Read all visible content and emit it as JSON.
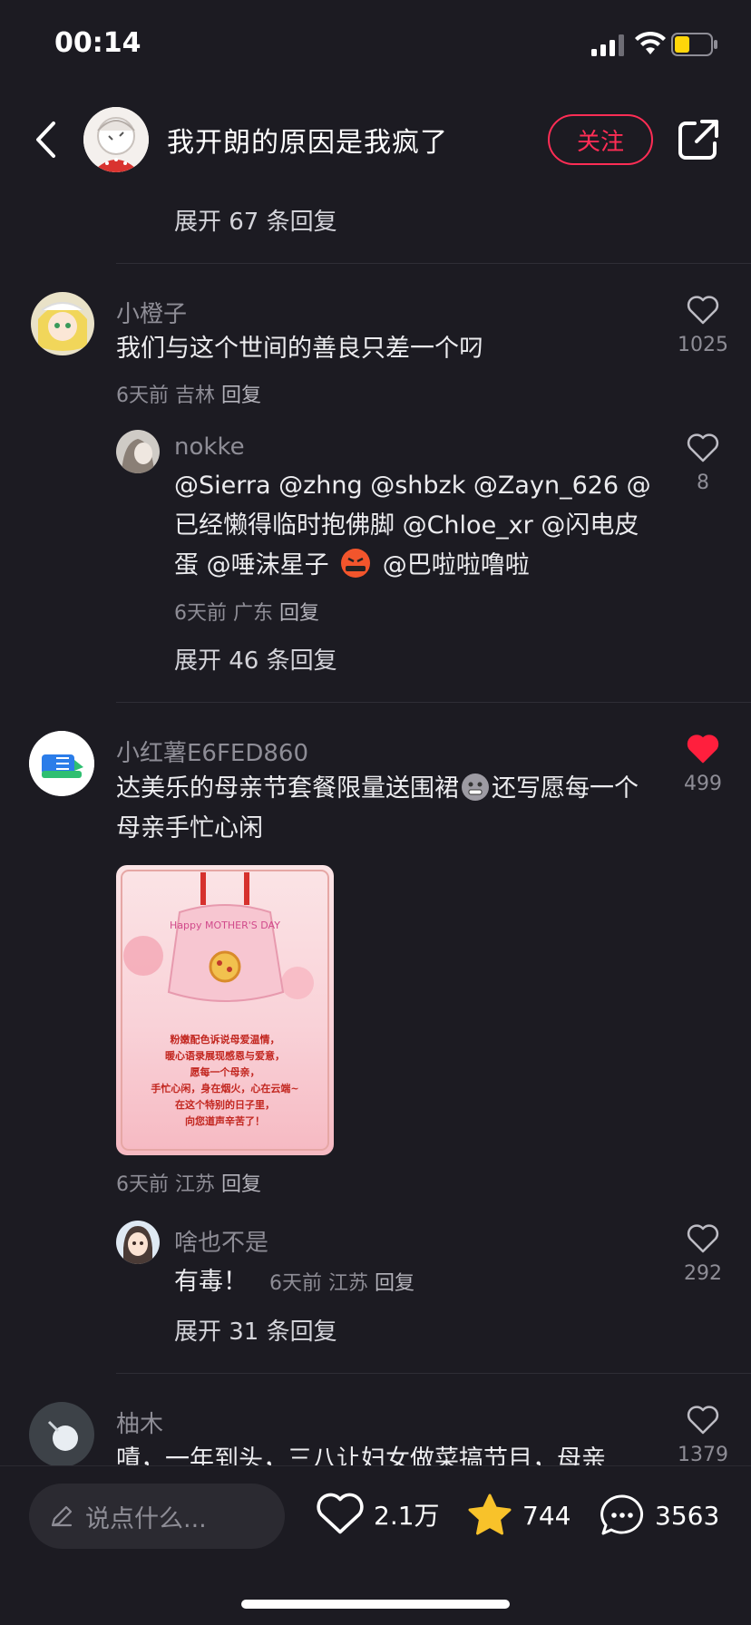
{
  "status": {
    "time": "00:14"
  },
  "header": {
    "title": "我开朗的原因是我疯了",
    "follow_label": "关注"
  },
  "top_expand": "展开 67 条回复",
  "comments": [
    {
      "username": "小橙子",
      "text": "我们与这个世间的善良只差一个叼",
      "time": "6天前",
      "location": "吉林",
      "reply_label": "回复",
      "likes": "1025",
      "liked": false,
      "replies": [
        {
          "username": "nokke",
          "text": "@Sierra @zhng @shbzk @Zayn_626 @已经懒得临时抱佛脚 @Chloe_xr @闪电皮蛋 @唾沫星子",
          "text_tail": "@巴啦啦噜啦",
          "time": "6天前",
          "location": "广东",
          "reply_label": "回复",
          "likes": "8"
        }
      ],
      "expand": "展开 46 条回复"
    },
    {
      "username": "小红薯E6FED860",
      "text_before_emoji": "达美乐的母亲节套餐限量送围裙",
      "text_after_emoji": "还写愿每一个母亲手忙心闲",
      "time": "6天前",
      "location": "江苏",
      "reply_label": "回复",
      "likes": "499",
      "liked": true,
      "image": {
        "banner": "Happy MOTHER'S DAY",
        "lines": [
          "粉嫩配色诉说母爱温情，",
          "暖心语录展现感恩与爱意，",
          "愿每一个母亲，",
          "手忙心闲，身在烟火，心在云端~",
          "在这个特别的日子里，",
          "向您道声辛苦了！"
        ]
      },
      "replies": [
        {
          "username": "啥也不是",
          "text": "有毒！",
          "time": "6天前",
          "location": "江苏",
          "reply_label": "回复",
          "likes": "292"
        }
      ],
      "expand": "展开 31 条回复"
    },
    {
      "username": "柚木",
      "text": "嘖，一年到头，三八让妇女做菜搞节目，母亲",
      "likes": "1379",
      "liked": false
    }
  ],
  "bottom": {
    "input_placeholder": "说点什么...",
    "likes": "2.1万",
    "favorites": "744",
    "comments": "3563"
  },
  "colors": {
    "background": "#1c1b22",
    "accent_red": "#ff2d55",
    "like_red": "#ff1f3d",
    "star_yellow": "#f8c22a"
  }
}
